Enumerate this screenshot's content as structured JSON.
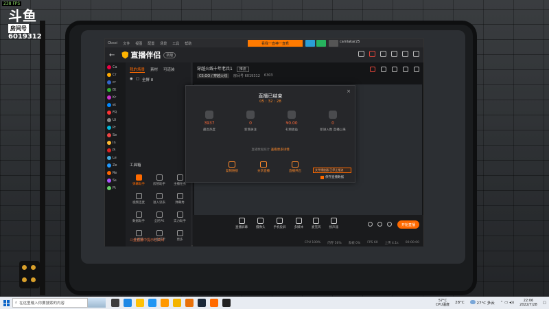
{
  "overlay": {
    "fps": "238 FPS",
    "platform_logo": "斗鱼",
    "room_label": "房间号",
    "room_number": "6019312"
  },
  "app": {
    "window_title": "直播伴侣",
    "version_badge": "新版",
    "titlebar_items": [
      "Obsei",
      "文件",
      "视图",
      "配置",
      "场景",
      "工具",
      "帮助"
    ],
    "banner_text": "看我一直神一直秀",
    "username": "camlakar25",
    "left_tabs": [
      "我的场景",
      "素材",
      "可道装"
    ],
    "active_left_tab": "我的场景",
    "scene_name": "全屏 8",
    "tools_title": "工具箱",
    "tools": [
      {
        "label": "弹幕助手",
        "hot": true
      },
      {
        "label": "房管助手",
        "hot": false
      },
      {
        "label": "主播任务",
        "hot": false
      },
      {
        "label": "视频连麦",
        "hot": false
      },
      {
        "label": "进入读表",
        "hot": false
      },
      {
        "label": "弹幕秀",
        "hot": false
      },
      {
        "label": "数据助手",
        "hot": false
      },
      {
        "label": "全民PK",
        "hot": false
      },
      {
        "label": "实力助手",
        "hot": false
      },
      {
        "label": "小视频",
        "hot": false
      },
      {
        "label": "斗鱼打卡",
        "hot": false
      },
      {
        "label": "更多",
        "hot": false
      }
    ],
    "left_bottom_notice": "斗鱼直播中提示已关闭",
    "obs_sources": [
      "Ca",
      "Cr",
      "cr",
      "Bt",
      "Kr",
      "et",
      "FR",
      "Ui",
      "Pr",
      "Se",
      "In",
      "Pi",
      "Le",
      "Ze",
      "Re",
      "Ss",
      "Pt"
    ],
    "room_title": "穿越火线十年老兵1",
    "room_badge": "推流",
    "room_category": "CS:GO / 穿越火线",
    "room_id_text": "房间号 6019312",
    "room_heat": "6303",
    "bottom_tools": [
      "直播屏幕",
      "摄像头",
      "手机投屏",
      "多媒体",
      "麦克风",
      "扬声器"
    ],
    "start_button": "开始直播",
    "status": [
      "CPU 100%",
      "内存 56%",
      "丢帧 0%",
      "FPS 60",
      "上传 4.1k",
      "00:00:00"
    ]
  },
  "dialog": {
    "title": "直播已结束",
    "duration": "05 : 32 : 28",
    "close": "×",
    "stats": [
      {
        "value": "3937",
        "label": "最高热度"
      },
      {
        "value": "0",
        "label": "新增关注"
      },
      {
        "value": "¥0.00",
        "label": "礼物收益"
      },
      {
        "value": "0",
        "label": "新进入数\n直播以来"
      }
    ],
    "note_prefix": "直播数据统计 ",
    "note_link": "查看更多详情",
    "note_suffix": "",
    "actions": [
      "复制链接",
      "分享直播",
      "直播开启"
    ],
    "tooltip": "文件播放器 已停止推流",
    "checkbox_label": "保存直播数据"
  },
  "taskbar": {
    "search_placeholder": "在这里输入你要搜索的内容",
    "cpu_temp": "57°C",
    "cpu_label": "CPU温度",
    "cpu_value": "28°C",
    "weather": "27°C 多云",
    "time": "22:06",
    "date": "2022/7/28"
  },
  "colors": {
    "accent": "#ff6a00",
    "taskbar": "#e8ecf2"
  }
}
